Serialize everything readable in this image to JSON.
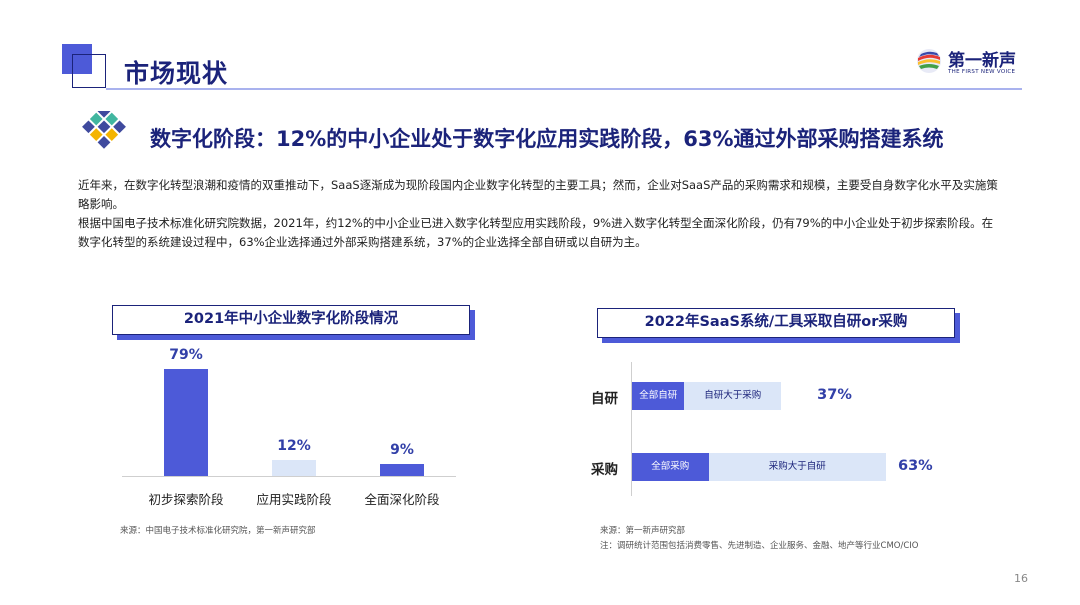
{
  "header": {
    "title": "市场现状",
    "logo_cn": "第一新声",
    "logo_en": "THE FIRST NEW VOICE"
  },
  "subheading": "数字化阶段：12%的中小企业处于数字化应用实践阶段，63%通过外部采购搭建系统",
  "body": {
    "para1": "近年来，在数字化转型浪潮和疫情的双重推动下，SaaS逐渐成为现阶段国内企业数字化转型的主要工具；然而，企业对SaaS产品的采购需求和规模，主要受自身数字化水平及实施策略影响。",
    "para2": "根据中国电子技术标准化研究院数据，2021年，约12%的中小企业已进入数字化转型应用实践阶段，9%进入数字化转型全面深化阶段，仍有79%的中小企业处于初步探索阶段。在数字化转型的系统建设过程中，63%企业选择通过外部采购搭建系统，37%的企业选择全部自研或以自研为主。"
  },
  "chart_data": [
    {
      "type": "bar",
      "title": "2021年中小企业数字化阶段情况",
      "categories": [
        "初步探索阶段",
        "应用实践阶段",
        "全面深化阶段"
      ],
      "values": [
        79,
        12,
        9
      ],
      "value_labels": [
        "79%",
        "12%",
        "9%"
      ],
      "ylim": [
        0,
        80
      ],
      "colors": [
        "#4d5ad8",
        "#dbe6f8",
        "#4d5ad8"
      ],
      "source": "来源：中国电子技术标准化研究院，第一新声研究部"
    },
    {
      "type": "bar",
      "orientation": "horizontal",
      "title": "2022年SaaS系统/工具采取自研or采购",
      "categories": [
        "自研",
        "采购"
      ],
      "series": [
        {
          "segments": [
            {
              "label": "全部自研",
              "value": 13
            },
            {
              "label": "自研大于采购",
              "value": 24
            }
          ]
        },
        {
          "segments": [
            {
              "label": "全部采购",
              "value": 19
            },
            {
              "label": "采购大于自研",
              "value": 44
            }
          ]
        }
      ],
      "totals": [
        "37%",
        "63%"
      ],
      "xlim": [
        0,
        63
      ],
      "source": "来源：第一新声研究部",
      "note": "注：调研统计范围包括消费零售、先进制造、企业服务、金融、地产等行业CMO/CIO"
    }
  ],
  "page_number": "16",
  "colors": {
    "primary": "#4d5ad8",
    "navy": "#1b237a",
    "light": "#dbe6f8"
  }
}
